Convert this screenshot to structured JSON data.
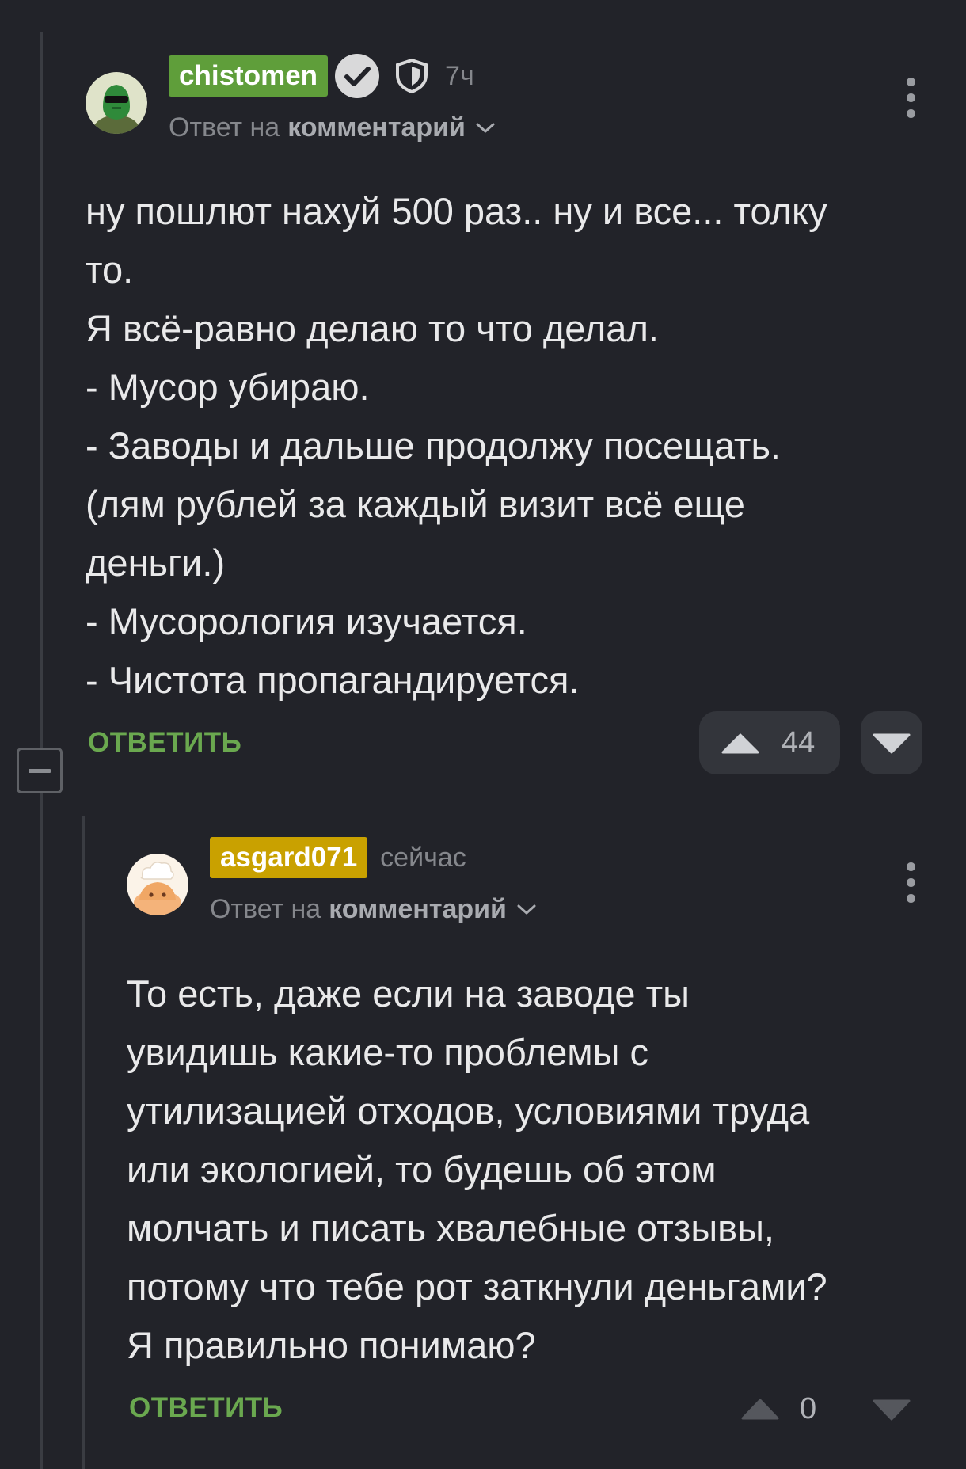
{
  "comments": [
    {
      "username": "chistomen",
      "username_color": "#5f9e3a",
      "verified": true,
      "time": "7ч",
      "reply_prefix": "Ответ на",
      "reply_target": "комментарий",
      "lines": [
        "ну пошлют нахуй 500 раз.. ну и все... толку",
        "то.",
        "Я всё-равно делаю то что делал.",
        "- Мусор убираю.",
        "- Заводы и дальше продолжу посещать.",
        "(лям рублей за каждый визит всё еще",
        "деньги.)",
        "- Мусорология изучается.",
        "- Чистота пропагандируется."
      ],
      "reply_label": "ОТВЕТИТЬ",
      "rating": "44"
    },
    {
      "username": "asgard071",
      "username_color": "#c9a100",
      "time": "сейчас",
      "reply_prefix": "Ответ на",
      "reply_target": "комментарий",
      "lines": [
        "То есть, даже если на заводе ты",
        "увидишь какие-то проблемы с",
        "утилизацией отходов, условиями труда",
        "или экологией, то будешь об этом",
        "молчать и писать хвалебные отзывы,",
        "потому что тебе рот заткнули деньгами?",
        "Я правильно понимаю?"
      ],
      "reply_label": "ОТВЕТИТЬ",
      "rating": "0"
    }
  ]
}
